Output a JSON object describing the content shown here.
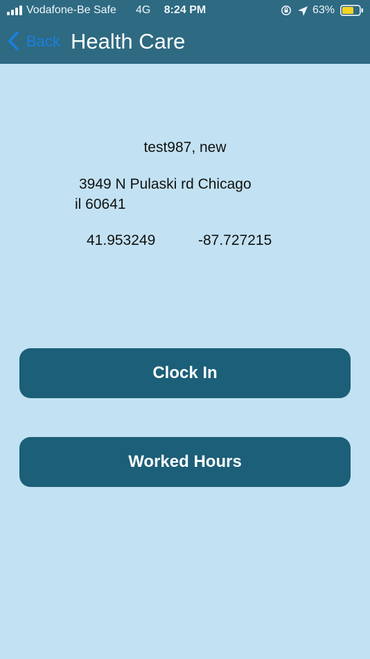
{
  "status_bar": {
    "carrier": "Vodafone-Be Safe",
    "network": "4G",
    "time": "8:24 PM",
    "battery_percent": "63%",
    "icons": [
      "signal-icon",
      "orientation-lock-icon",
      "location-arrow-icon",
      "battery-icon"
    ],
    "battery_color": "#f5d327"
  },
  "nav": {
    "back_label": "Back",
    "title": "Health Care",
    "bar_color": "#2e6a82",
    "back_color": "#1a7fe0"
  },
  "client": {
    "name": "test987, new",
    "address_line1": "3949 N Pulaski rd  Chicago",
    "address_line2": "il 60641",
    "latitude": "41.953249",
    "longitude": "-87.727215"
  },
  "actions": {
    "clock_in_label": "Clock In",
    "worked_hours_label": "Worked Hours",
    "button_color": "#1c5f78"
  },
  "theme": {
    "background": "#c2e2f3"
  }
}
